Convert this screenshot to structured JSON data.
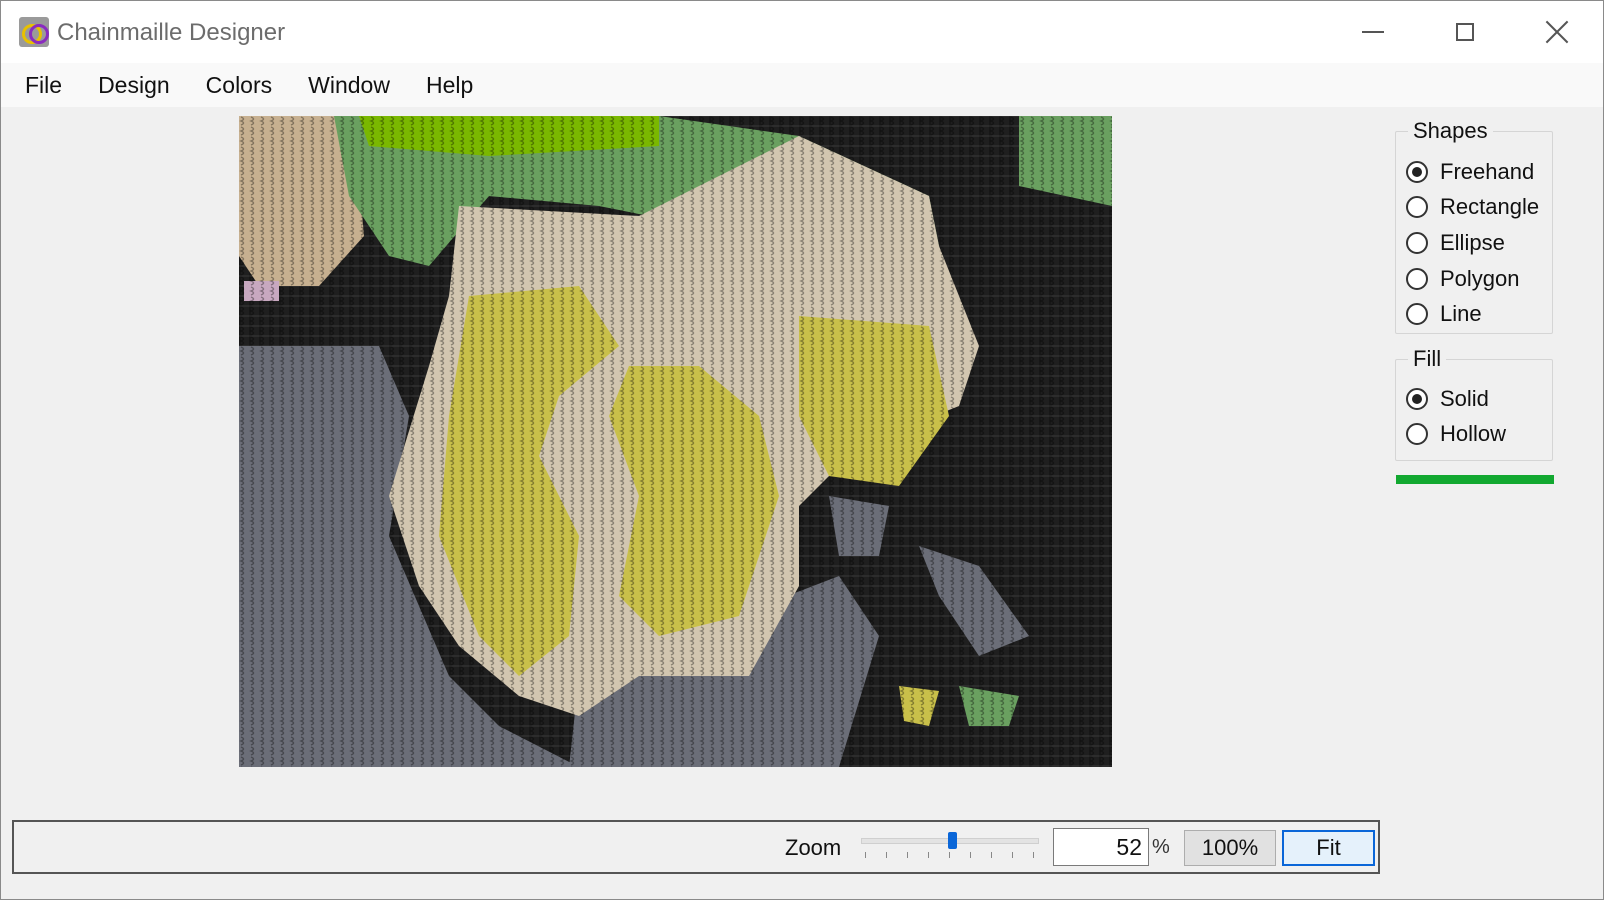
{
  "window": {
    "title": "Chainmaille Designer",
    "icon": "chainmaille-rings-icon"
  },
  "menu": [
    "File",
    "Design",
    "Colors",
    "Window",
    "Help"
  ],
  "shapes": {
    "title": "Shapes",
    "options": [
      "Freehand",
      "Rectangle",
      "Ellipse",
      "Polygon",
      "Line"
    ],
    "selected": "Freehand"
  },
  "fill": {
    "title": "Fill",
    "options": [
      "Solid",
      "Hollow"
    ],
    "selected": "Solid"
  },
  "colors": {
    "selected_color": "#12a830",
    "canvas_background": "#1f1f1f",
    "ring_palette": [
      "#6b6e78",
      "#c7b090",
      "#c9c04a",
      "#d9d9d9",
      "#6aa060",
      "#7ab800",
      "#c8a8c0"
    ]
  },
  "zoom": {
    "label": "Zoom",
    "value": "52",
    "unit": "%",
    "slider_level": 0.52,
    "btn_100": "100%",
    "btn_fit": "Fit"
  }
}
